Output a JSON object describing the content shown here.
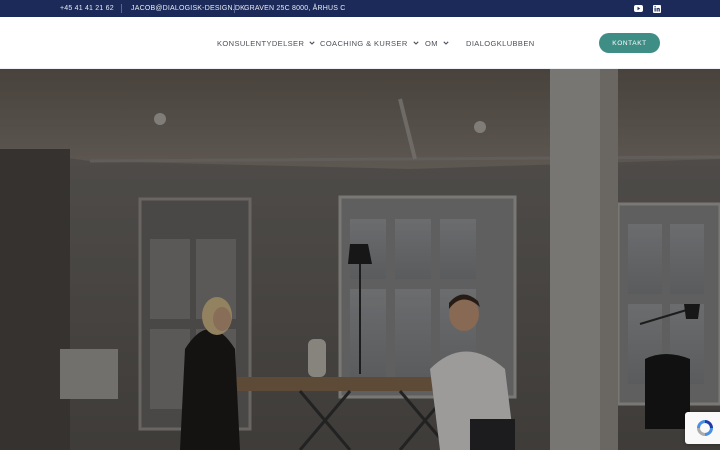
{
  "topbar": {
    "phone": "+45 41 41 21 62",
    "email": "JACOB@DIALOGISK-DESIGN.DK",
    "address": "GRAVEN 25C 8000, ÅRHUS C",
    "social_icons": [
      "youtube-icon",
      "linkedin-icon"
    ]
  },
  "nav": {
    "items": [
      {
        "label": "KONSULENTYDELSER",
        "dropdown": true
      },
      {
        "label": "COACHING & KURSER",
        "dropdown": true
      },
      {
        "label": "OM",
        "dropdown": true
      },
      {
        "label": "DIALOGKLUBBEN",
        "dropdown": false
      }
    ],
    "cta_label": "KONTAKT"
  },
  "colors": {
    "topbar_bg": "#1c2a5a",
    "cta_bg": "#3f8e86",
    "nav_text": "#4c4f5a"
  },
  "hero": {
    "image": "office-meeting-photo"
  }
}
